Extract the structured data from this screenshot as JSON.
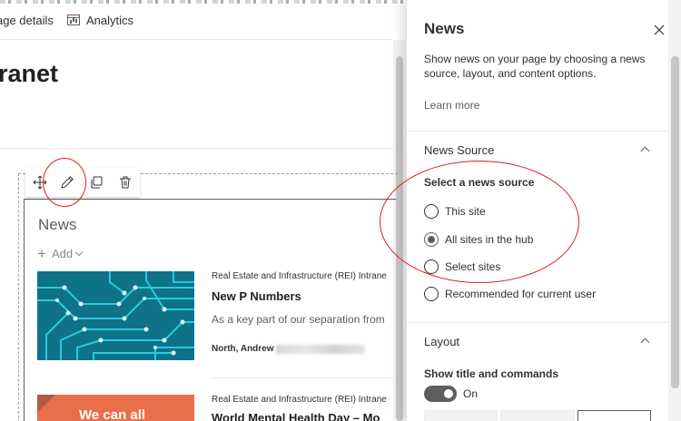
{
  "command_bar": {
    "page_details": "age details",
    "analytics": "Analytics"
  },
  "site": {
    "title": "ranet"
  },
  "webpart": {
    "toolbar": {
      "move_icon": "move-icon",
      "edit_icon": "pencil-icon",
      "duplicate_icon": "duplicate-icon",
      "delete_icon": "trash-icon"
    },
    "title": "News",
    "add_label": "Add",
    "items": [
      {
        "source": "Real Estate and Infrastructure (REI) Intrane",
        "title": "New P Numbers",
        "description": "As a key part of our separation from",
        "author": "North, Andrew"
      },
      {
        "source": "Real Estate and Infrastructure (REI) Intrane",
        "title": "World Mental Health Day – Mo",
        "thumbnail_text": "We can all"
      }
    ]
  },
  "pane": {
    "title": "News",
    "description": "Show news on your page by choosing a news source, layout, and content options.",
    "learn_more": "Learn more",
    "news_source": {
      "header": "News Source",
      "field_label": "Select a news source",
      "options": [
        "This site",
        "All sites in the hub",
        "Select sites",
        "Recommended for current user"
      ],
      "selected": "All sites in the hub"
    },
    "layout": {
      "header": "Layout",
      "show_title_label": "Show title and commands",
      "toggle_state": "On"
    }
  },
  "colors": {
    "annotation": "#e31c1c",
    "thumbnail_primary": "#1aa6b7",
    "thumbnail_secondary": "#e96f4b"
  }
}
